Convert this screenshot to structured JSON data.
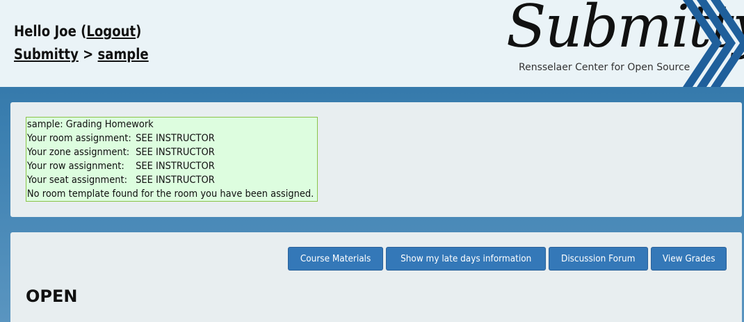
{
  "header": {
    "hello_prefix": "Hello Joe (",
    "logout_label": "Logout",
    "hello_suffix": ")",
    "breadcrumb_root": "Submitty",
    "breadcrumb_sep": " > ",
    "breadcrumb_course": "sample"
  },
  "logo": {
    "wordmark": "Submitty",
    "tagline": "Rensselaer Center for Open Source"
  },
  "seating": {
    "title": "sample: Grading Homework",
    "rows": [
      {
        "label": "Your room assignment:",
        "value": "SEE INSTRUCTOR"
      },
      {
        "label": "Your zone assignment:",
        "value": "SEE INSTRUCTOR"
      },
      {
        "label": "Your row assignment:",
        "value": "SEE INSTRUCTOR"
      },
      {
        "label": "Your seat assignment:",
        "value": "SEE INSTRUCTOR"
      }
    ],
    "note": "No room template found for the room you have been assigned."
  },
  "buttons": {
    "course_materials": "Course Materials",
    "late_days": "Show my late days information",
    "forum": "Discussion Forum",
    "grades": "View Grades"
  },
  "section": {
    "title": "OPEN"
  },
  "colors": {
    "primary_button": "#3478b8",
    "seating_bg": "#ddfddf",
    "header_bg": "#eaf3f7",
    "chevron": "#1f5f9b"
  }
}
